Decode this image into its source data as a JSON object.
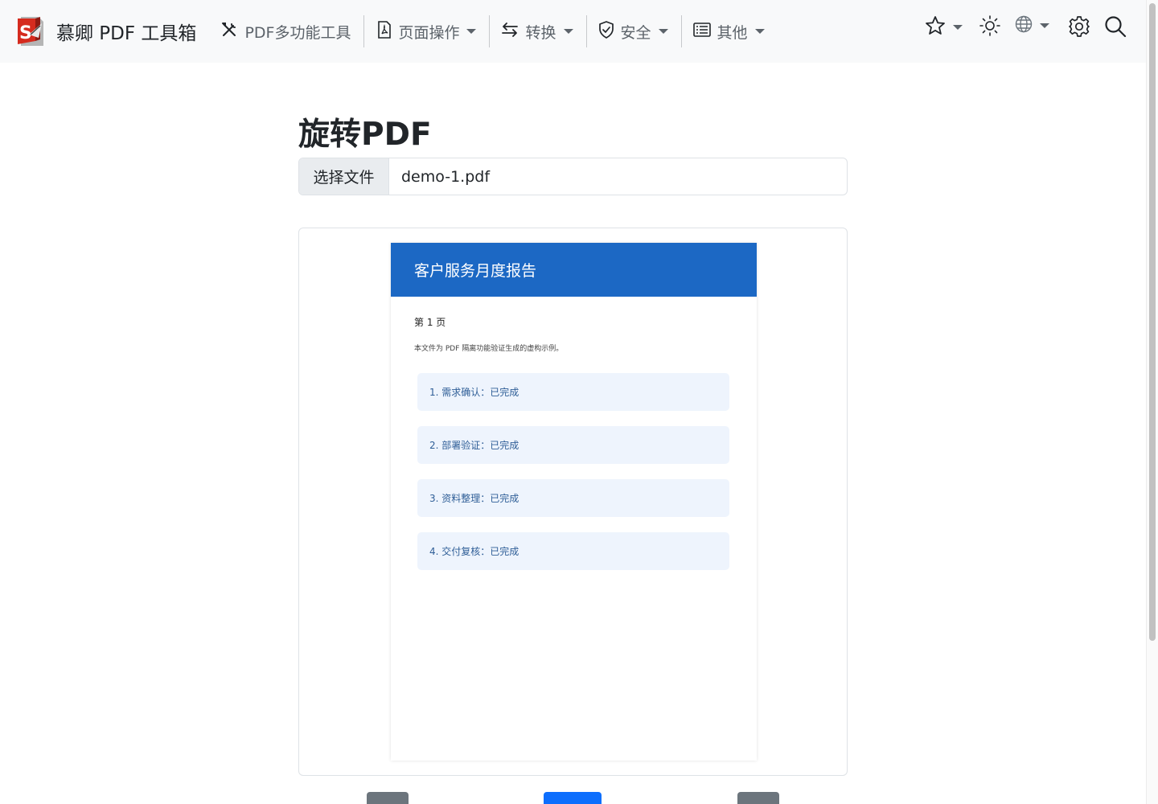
{
  "navbar": {
    "brand": "慕卿 PDF 工具箱",
    "items": [
      {
        "label": "PDF多功能工具",
        "icon": "tools-icon"
      },
      {
        "label": "页面操作",
        "icon": "file-pdf-icon"
      },
      {
        "label": "转换",
        "icon": "arrows-exchange-icon"
      },
      {
        "label": "安全",
        "icon": "shield-icon"
      },
      {
        "label": "其他",
        "icon": "list-icon"
      }
    ],
    "right_icons": [
      "star-icon",
      "sun-icon",
      "globe-icon",
      "gear-icon",
      "search-icon"
    ]
  },
  "main": {
    "title": "旋转PDF",
    "file_button": "选择文件",
    "file_name": "demo-1.pdf"
  },
  "preview": {
    "header": "客户服务月度报告",
    "page_number": "第 1 页",
    "description": "本文件为 PDF 隔离功能验证生成的虚构示例。",
    "tasks": [
      "1. 需求确认：已完成",
      "2. 部署验证：已完成",
      "3. 资料整理：已完成",
      "4. 交付复核：已完成"
    ]
  },
  "colors": {
    "accent": "#0d6efd",
    "page_header": "#1c68c4",
    "secondary": "#6c757d",
    "navbar_bg": "#f8f9fa"
  }
}
